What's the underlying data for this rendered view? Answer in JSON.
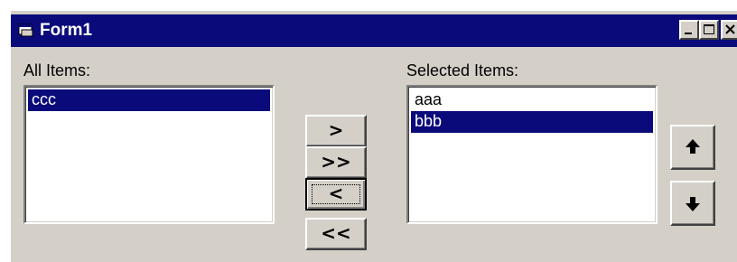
{
  "window": {
    "title": "Form1",
    "controls": {
      "minimize_icon": "minimize-icon",
      "maximize_icon": "maximize-icon",
      "close_icon": "close-icon"
    }
  },
  "colors": {
    "face": "#d4d0c8",
    "titlebar": "#0a0a7a",
    "selection": "#0a0a7a",
    "selection_text": "#ffffff"
  },
  "all_items": {
    "label": "All Items:",
    "items": [
      {
        "text": "ccc",
        "selected": true
      }
    ]
  },
  "selected_items": {
    "label": "Selected Items:",
    "items": [
      {
        "text": "aaa",
        "selected": false
      },
      {
        "text": "bbb",
        "selected": true
      }
    ]
  },
  "transfer_buttons": {
    "add": ">",
    "add_all": ">>",
    "remove": "<",
    "remove_all": "<<",
    "focused": "remove"
  },
  "order_buttons": {
    "up_icon": "arrow-up-icon",
    "down_icon": "arrow-down-icon"
  }
}
